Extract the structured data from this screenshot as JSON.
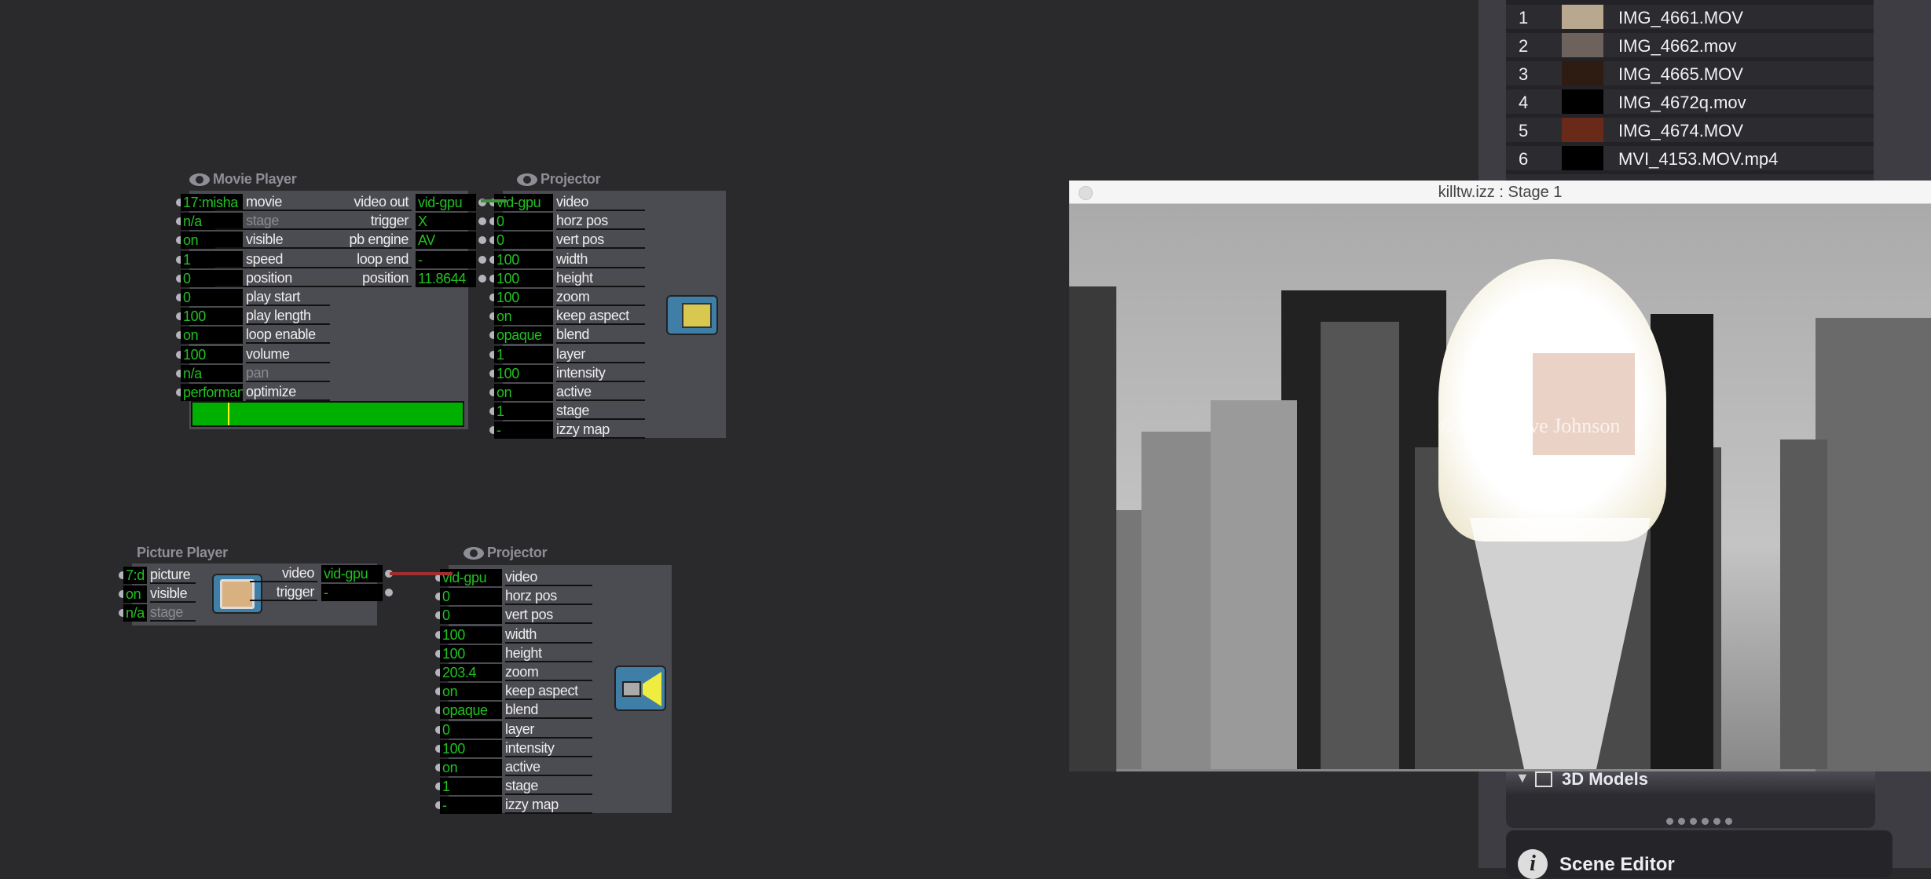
{
  "movie_player": {
    "title": "Movie Player",
    "bar_position": 0.13,
    "inputs": [
      {
        "value": "17:misha",
        "label": "movie"
      },
      {
        "value": "n/a",
        "label": "stage",
        "dim": true
      },
      {
        "value": "on",
        "label": "visible"
      },
      {
        "value": "1",
        "label": "speed"
      },
      {
        "value": "0",
        "label": "position"
      },
      {
        "value": "0",
        "label": "play start"
      },
      {
        "value": "100",
        "label": "play length"
      },
      {
        "value": "on",
        "label": "loop enable"
      },
      {
        "value": "100",
        "label": "volume"
      },
      {
        "value": "n/a",
        "label": "pan",
        "dim": true
      },
      {
        "value": "performance",
        "label": "optimize"
      }
    ],
    "outputs": [
      {
        "label": "video out",
        "value": "vid-gpu"
      },
      {
        "label": "trigger",
        "value": "X"
      },
      {
        "label": "pb engine",
        "value": "AV"
      },
      {
        "label": "loop end",
        "value": "-"
      },
      {
        "label": "position",
        "value": "11.8644"
      }
    ]
  },
  "projector_1": {
    "title": "Projector",
    "icon": "projector-map-icon",
    "inputs": [
      {
        "value": "vid-gpu",
        "label": "video"
      },
      {
        "value": "0",
        "label": "horz pos"
      },
      {
        "value": "0",
        "label": "vert pos"
      },
      {
        "value": "100",
        "label": "width"
      },
      {
        "value": "100",
        "label": "height"
      },
      {
        "value": "100",
        "label": "zoom"
      },
      {
        "value": "on",
        "label": "keep aspect"
      },
      {
        "value": "opaque",
        "label": "blend"
      },
      {
        "value": "1",
        "label": "layer"
      },
      {
        "value": "100",
        "label": "intensity"
      },
      {
        "value": "on",
        "label": "active"
      },
      {
        "value": "1",
        "label": "stage"
      },
      {
        "value": "-",
        "label": "izzy map"
      }
    ]
  },
  "picture_player": {
    "title": "Picture Player",
    "inputs": [
      {
        "value": "7:d",
        "label": "picture"
      },
      {
        "value": "on",
        "label": "visible"
      },
      {
        "value": "n/a",
        "label": "stage",
        "dim": true
      }
    ],
    "outputs": [
      {
        "label": "video",
        "value": "vid-gpu"
      },
      {
        "label": "trigger",
        "value": "-"
      }
    ]
  },
  "projector_2": {
    "title": "Projector",
    "icon": "projector-icon",
    "inputs": [
      {
        "value": "vid-gpu",
        "label": "video"
      },
      {
        "value": "0",
        "label": "horz pos"
      },
      {
        "value": "0",
        "label": "vert pos"
      },
      {
        "value": "100",
        "label": "width"
      },
      {
        "value": "100",
        "label": "height"
      },
      {
        "value": "203.4",
        "label": "zoom"
      },
      {
        "value": "on",
        "label": "keep aspect"
      },
      {
        "value": "opaque",
        "label": "blend"
      },
      {
        "value": "0",
        "label": "layer"
      },
      {
        "value": "100",
        "label": "intensity"
      },
      {
        "value": "on",
        "label": "active"
      },
      {
        "value": "1",
        "label": "stage"
      },
      {
        "value": "-",
        "label": "izzy map"
      }
    ]
  },
  "connections": {
    "movie_to_projector": "#3f8f3f",
    "picture_to_projector": "#a03030"
  },
  "media_list": [
    {
      "num": "1",
      "name": "IMG_4661.MOV",
      "thumb": "#b8a890"
    },
    {
      "num": "2",
      "name": "IMG_4662.mov",
      "thumb": "#6e625c"
    },
    {
      "num": "3",
      "name": "IMG_4665.MOV",
      "thumb": "#2e1c12"
    },
    {
      "num": "4",
      "name": "IMG_4672q.mov",
      "thumb": "#000000"
    },
    {
      "num": "5",
      "name": "IMG_4674.MOV",
      "thumb": "#6a2a1a"
    },
    {
      "num": "6",
      "name": "MVI_4153.MOV.mp4",
      "thumb": "#000000"
    }
  ],
  "stage_window": {
    "title": "killtw.izz : Stage 1",
    "watermark": "© 2012 Dave Johnson"
  },
  "panels": {
    "models": "3D Models",
    "scene_editor": "Scene Editor"
  }
}
